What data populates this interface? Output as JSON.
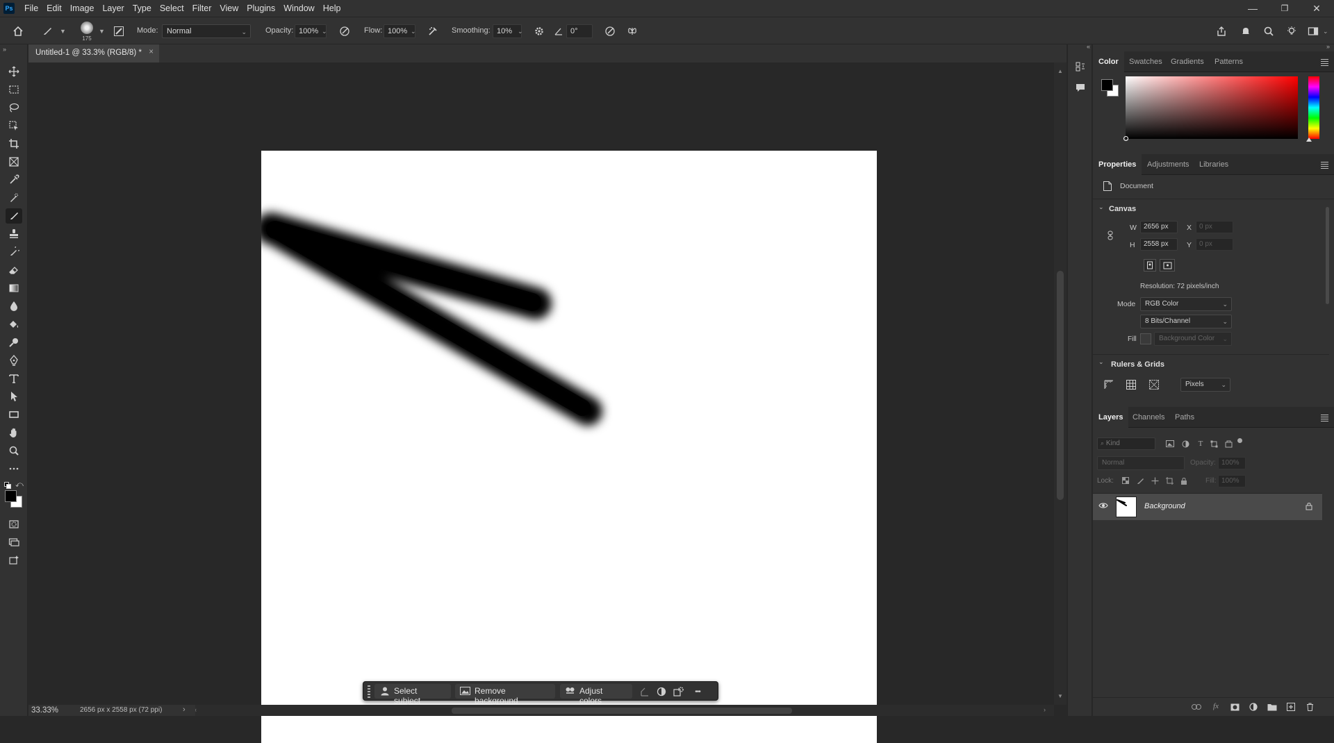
{
  "app": {
    "logo": "Ps"
  },
  "menu": [
    "File",
    "Edit",
    "Image",
    "Layer",
    "Type",
    "Select",
    "Filter",
    "View",
    "Plugins",
    "Window",
    "Help"
  ],
  "window_controls": {
    "minimize": "—",
    "restore": "❐",
    "close": "✕"
  },
  "options": {
    "brush_size": "175",
    "mode_label": "Mode:",
    "mode_value": "Normal",
    "opacity_label": "Opacity:",
    "opacity_value": "100%",
    "flow_label": "Flow:",
    "flow_value": "100%",
    "smoothing_label": "Smoothing:",
    "smoothing_value": "10%",
    "angle_value": "0°"
  },
  "document_tab": {
    "title": "Untitled-1 @ 33.3% (RGB/8) *",
    "close": "×"
  },
  "status": {
    "zoom": "33.33%",
    "doc_info": "2656 px x 2558 px (72 ppi)"
  },
  "taskbar": {
    "select_subject": "Select subject",
    "remove_background": "Remove background",
    "adjust_colors": "Adjust colors",
    "more": "•••"
  },
  "color_panel": {
    "tabs": [
      "Color",
      "Swatches",
      "Gradients",
      "Patterns"
    ],
    "foreground": "#000000",
    "background": "#ffffff",
    "hue": "#ff0000"
  },
  "properties_panel": {
    "tabs": [
      "Properties",
      "Adjustments",
      "Libraries"
    ],
    "document_label": "Document",
    "canvas_title": "Canvas",
    "w_label": "W",
    "w_value": "2656 px",
    "h_label": "H",
    "h_value": "2558 px",
    "x_label": "X",
    "x_value": "0 px",
    "y_label": "Y",
    "y_value": "0 px",
    "resolution": "Resolution: 72 pixels/inch",
    "mode_label": "Mode",
    "mode_value": "RGB Color",
    "bits_value": "8 Bits/Channel",
    "fill_label": "Fill",
    "fill_value": "Background Color",
    "rulers_title": "Rulers & Grids",
    "units_value": "Pixels"
  },
  "layers_panel": {
    "tabs": [
      "Layers",
      "Channels",
      "Paths"
    ],
    "kind_placeholder": "Kind",
    "blend_mode": "Normal",
    "opacity_label": "Opacity:",
    "opacity_value": "100%",
    "lock_label": "Lock:",
    "fill_label": "Fill:",
    "fill_value": "100%",
    "layers": [
      {
        "name": "Background",
        "visible": true,
        "locked": true
      }
    ]
  }
}
